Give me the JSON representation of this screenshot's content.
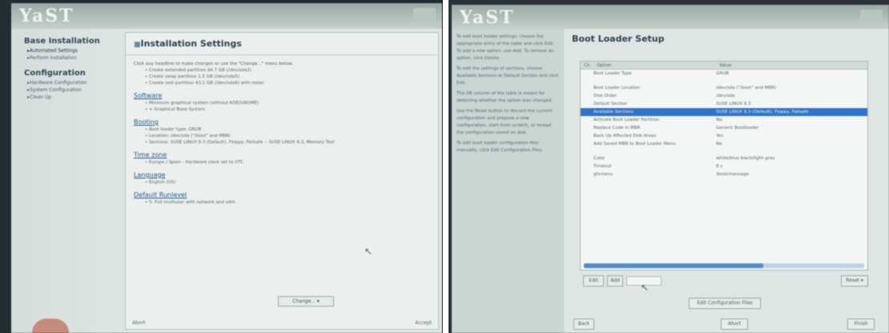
{
  "left_screen": {
    "logo": "YaST",
    "sidebar": {
      "sections": [
        {
          "heading": "Base Installation",
          "items": [
            "Automated Settings",
            "Perform Installation"
          ]
        },
        {
          "heading": "Configuration",
          "items": [
            "Hardware Configuration",
            "System Configuration",
            "Clean Up"
          ]
        }
      ]
    },
    "main": {
      "title": "Installation Settings",
      "intro": "Click any headline to make changes or use the \"Change...\" menu below.",
      "sections": [
        {
          "title": "",
          "bullets": [
            "Create extended partition 44.7 GB (/dev/sda2)",
            "Create swap partition 1.5 GB (/dev/sda5)",
            "Create root partition 43.1 GB (/dev/sda6) with reiser"
          ]
        },
        {
          "title": "Software",
          "bullets": [
            "Minimum graphical system (without KDE/GNOME)",
            "+ Graphical Base System"
          ]
        },
        {
          "title": "Booting",
          "bullets": [
            "Boot loader type: GRUB",
            "Location: /dev/sda (\"/boot\" and MBR)",
            "Sections: SUSE LINUX 9.3 (Default), Floppy, Failsafe -- SUSE LINUX 9.3, Memory Test"
          ]
        },
        {
          "title": "Time zone",
          "bullets": [
            "Europe / Spain - Hardware clock set to UTC"
          ]
        },
        {
          "title": "Language",
          "bullets": [
            "English (US)"
          ]
        },
        {
          "title": "Default Runlevel",
          "bullets": [
            "5: Full multiuser with network and xdm"
          ]
        }
      ],
      "change_button": "Change...",
      "footer_left": "Abort",
      "footer_right": "Accept"
    }
  },
  "right_screen": {
    "logo": "YaST",
    "help": [
      {
        "text": "To edit boot loader settings, choose the appropriate entry of the table and click Edit. To add a new option, use Add. To remove an option, click Delete."
      },
      {
        "text": "To edit the settings of sections, choose Available Sections or Default Section and click Edit."
      },
      {
        "text": "The OK column of the table is meant for detecting whether the option was changed."
      },
      {
        "text": "Use the Reset button to discard the current configuration and propose a new configuration, start from scratch, or reread the configuration saved on disk."
      },
      {
        "text": "To edit boot loader configuration files manually, click Edit Configuration Files."
      }
    ],
    "title": "Boot Loader Setup",
    "table": {
      "headers": [
        "Ch",
        "Option",
        "Value"
      ],
      "rows": [
        {
          "option": "Boot Loader Type",
          "value": "GRUB",
          "selected": false
        },
        {
          "option": "",
          "value": "",
          "selected": false
        },
        {
          "option": "Boot Loader Location",
          "value": "/dev/sda (\"/boot\" and MBR)",
          "selected": false
        },
        {
          "option": "Disk Order",
          "value": "/dev/sda",
          "selected": false
        },
        {
          "option": "Default Section",
          "value": "SUSE LINUX 9.3",
          "selected": false
        },
        {
          "option": "Available Sections",
          "value": "SUSE LINUX 9.3 (Default), Floppy, Failsafe",
          "selected": true
        },
        {
          "option": "Activate Boot Loader Partition",
          "value": "No",
          "selected": false
        },
        {
          "option": "Replace Code in MBR",
          "value": "Generic Bootloader",
          "selected": false
        },
        {
          "option": "Back Up Affected Disk Areas",
          "value": "Yes",
          "selected": false
        },
        {
          "option": "Add Saved MBR to Boot Loader Menu",
          "value": "No",
          "selected": false
        },
        {
          "option": "",
          "value": "",
          "selected": false
        },
        {
          "option": "Color",
          "value": "white/blue black/light-gray",
          "selected": false
        },
        {
          "option": "Timeout",
          "value": "8 s",
          "selected": false
        },
        {
          "option": "gfxmenu",
          "value": "/boot/message",
          "selected": false
        }
      ]
    },
    "edit_button": "Edit",
    "add_button": "Add",
    "reset_button": "Reset",
    "edit_config_button": "Edit Configuration Files",
    "back_button": "Back",
    "abort_button": "Abort",
    "finish_button": "Finish"
  }
}
